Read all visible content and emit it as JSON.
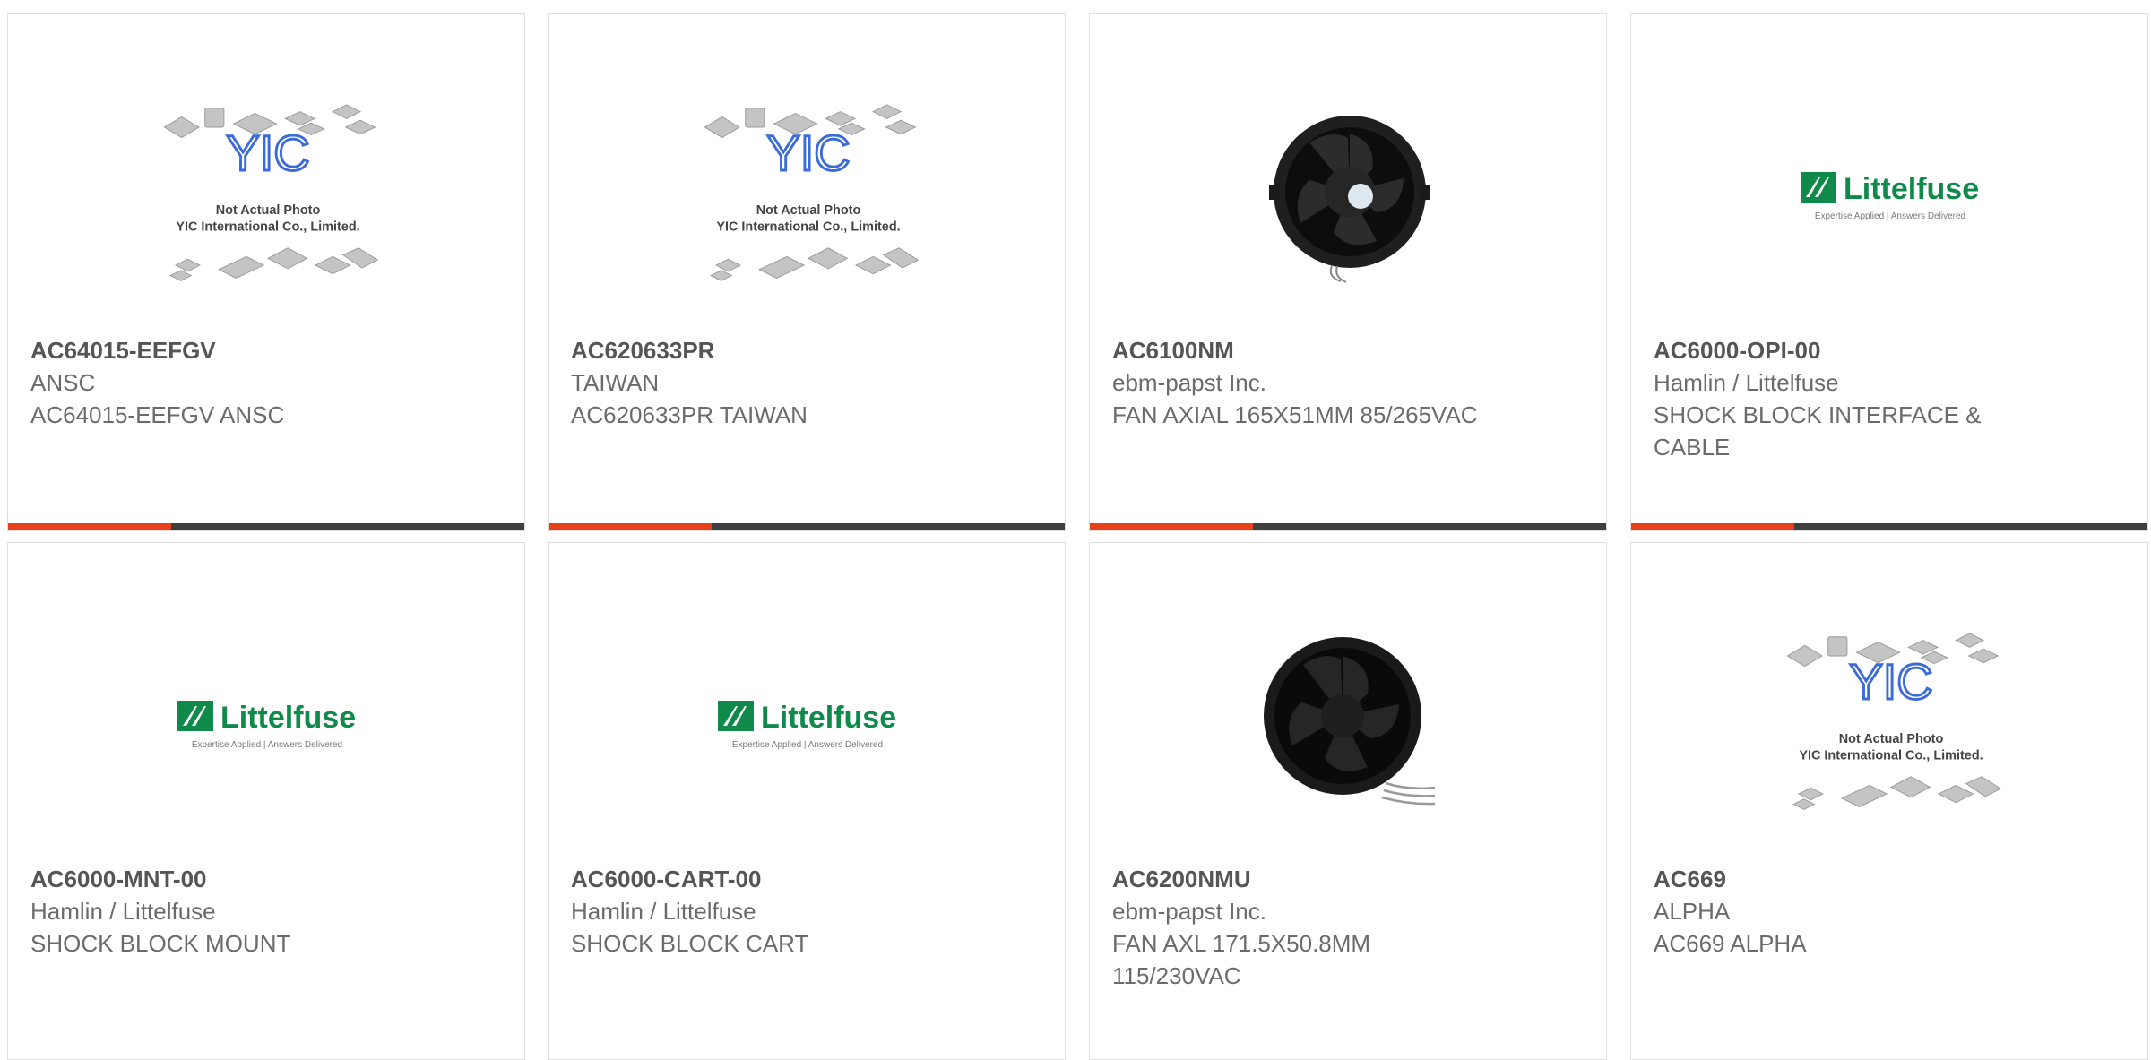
{
  "accent_color": "#e8401b",
  "bar_color": "#3f3f3f",
  "yic_logo": {
    "mark": "YIC",
    "line1": "Not Actual Photo",
    "line2": "YIC International Co., Limited."
  },
  "littelfuse_logo": {
    "name": "Littelfuse",
    "tagline": "Expertise Applied | Answers Delivered"
  },
  "products": [
    {
      "part": "AC64015-EEFGV",
      "manufacturer": "ANSC",
      "description": "AC64015-EEFGV ANSC",
      "image": "yic-placeholder-image"
    },
    {
      "part": "AC620633PR",
      "manufacturer": "TAIWAN",
      "description": "AC620633PR TAIWAN",
      "image": "yic-placeholder-image"
    },
    {
      "part": "AC6100NM",
      "manufacturer": "ebm-papst Inc.",
      "description": "FAN AXIAL 165X51MM 85/265VAC",
      "image": "axial-fan-image"
    },
    {
      "part": "AC6000-OPI-00",
      "manufacturer": "Hamlin / Littelfuse",
      "description": "SHOCK BLOCK INTERFACE & CABLE",
      "image": "littelfuse-logo"
    },
    {
      "part": "AC6000-MNT-00",
      "manufacturer": "Hamlin / Littelfuse",
      "description": "SHOCK BLOCK MOUNT",
      "image": "littelfuse-logo"
    },
    {
      "part": "AC6000-CART-00",
      "manufacturer": "Hamlin / Littelfuse",
      "description": "SHOCK BLOCK CART",
      "image": "littelfuse-logo"
    },
    {
      "part": "AC6200NMU",
      "manufacturer": "ebm-papst Inc.",
      "description": "FAN AXL 171.5X50.8MM 115/230VAC",
      "image": "axial-fan-image"
    },
    {
      "part": "AC669",
      "manufacturer": "ALPHA",
      "description": "AC669 ALPHA",
      "image": "yic-placeholder-image"
    }
  ]
}
